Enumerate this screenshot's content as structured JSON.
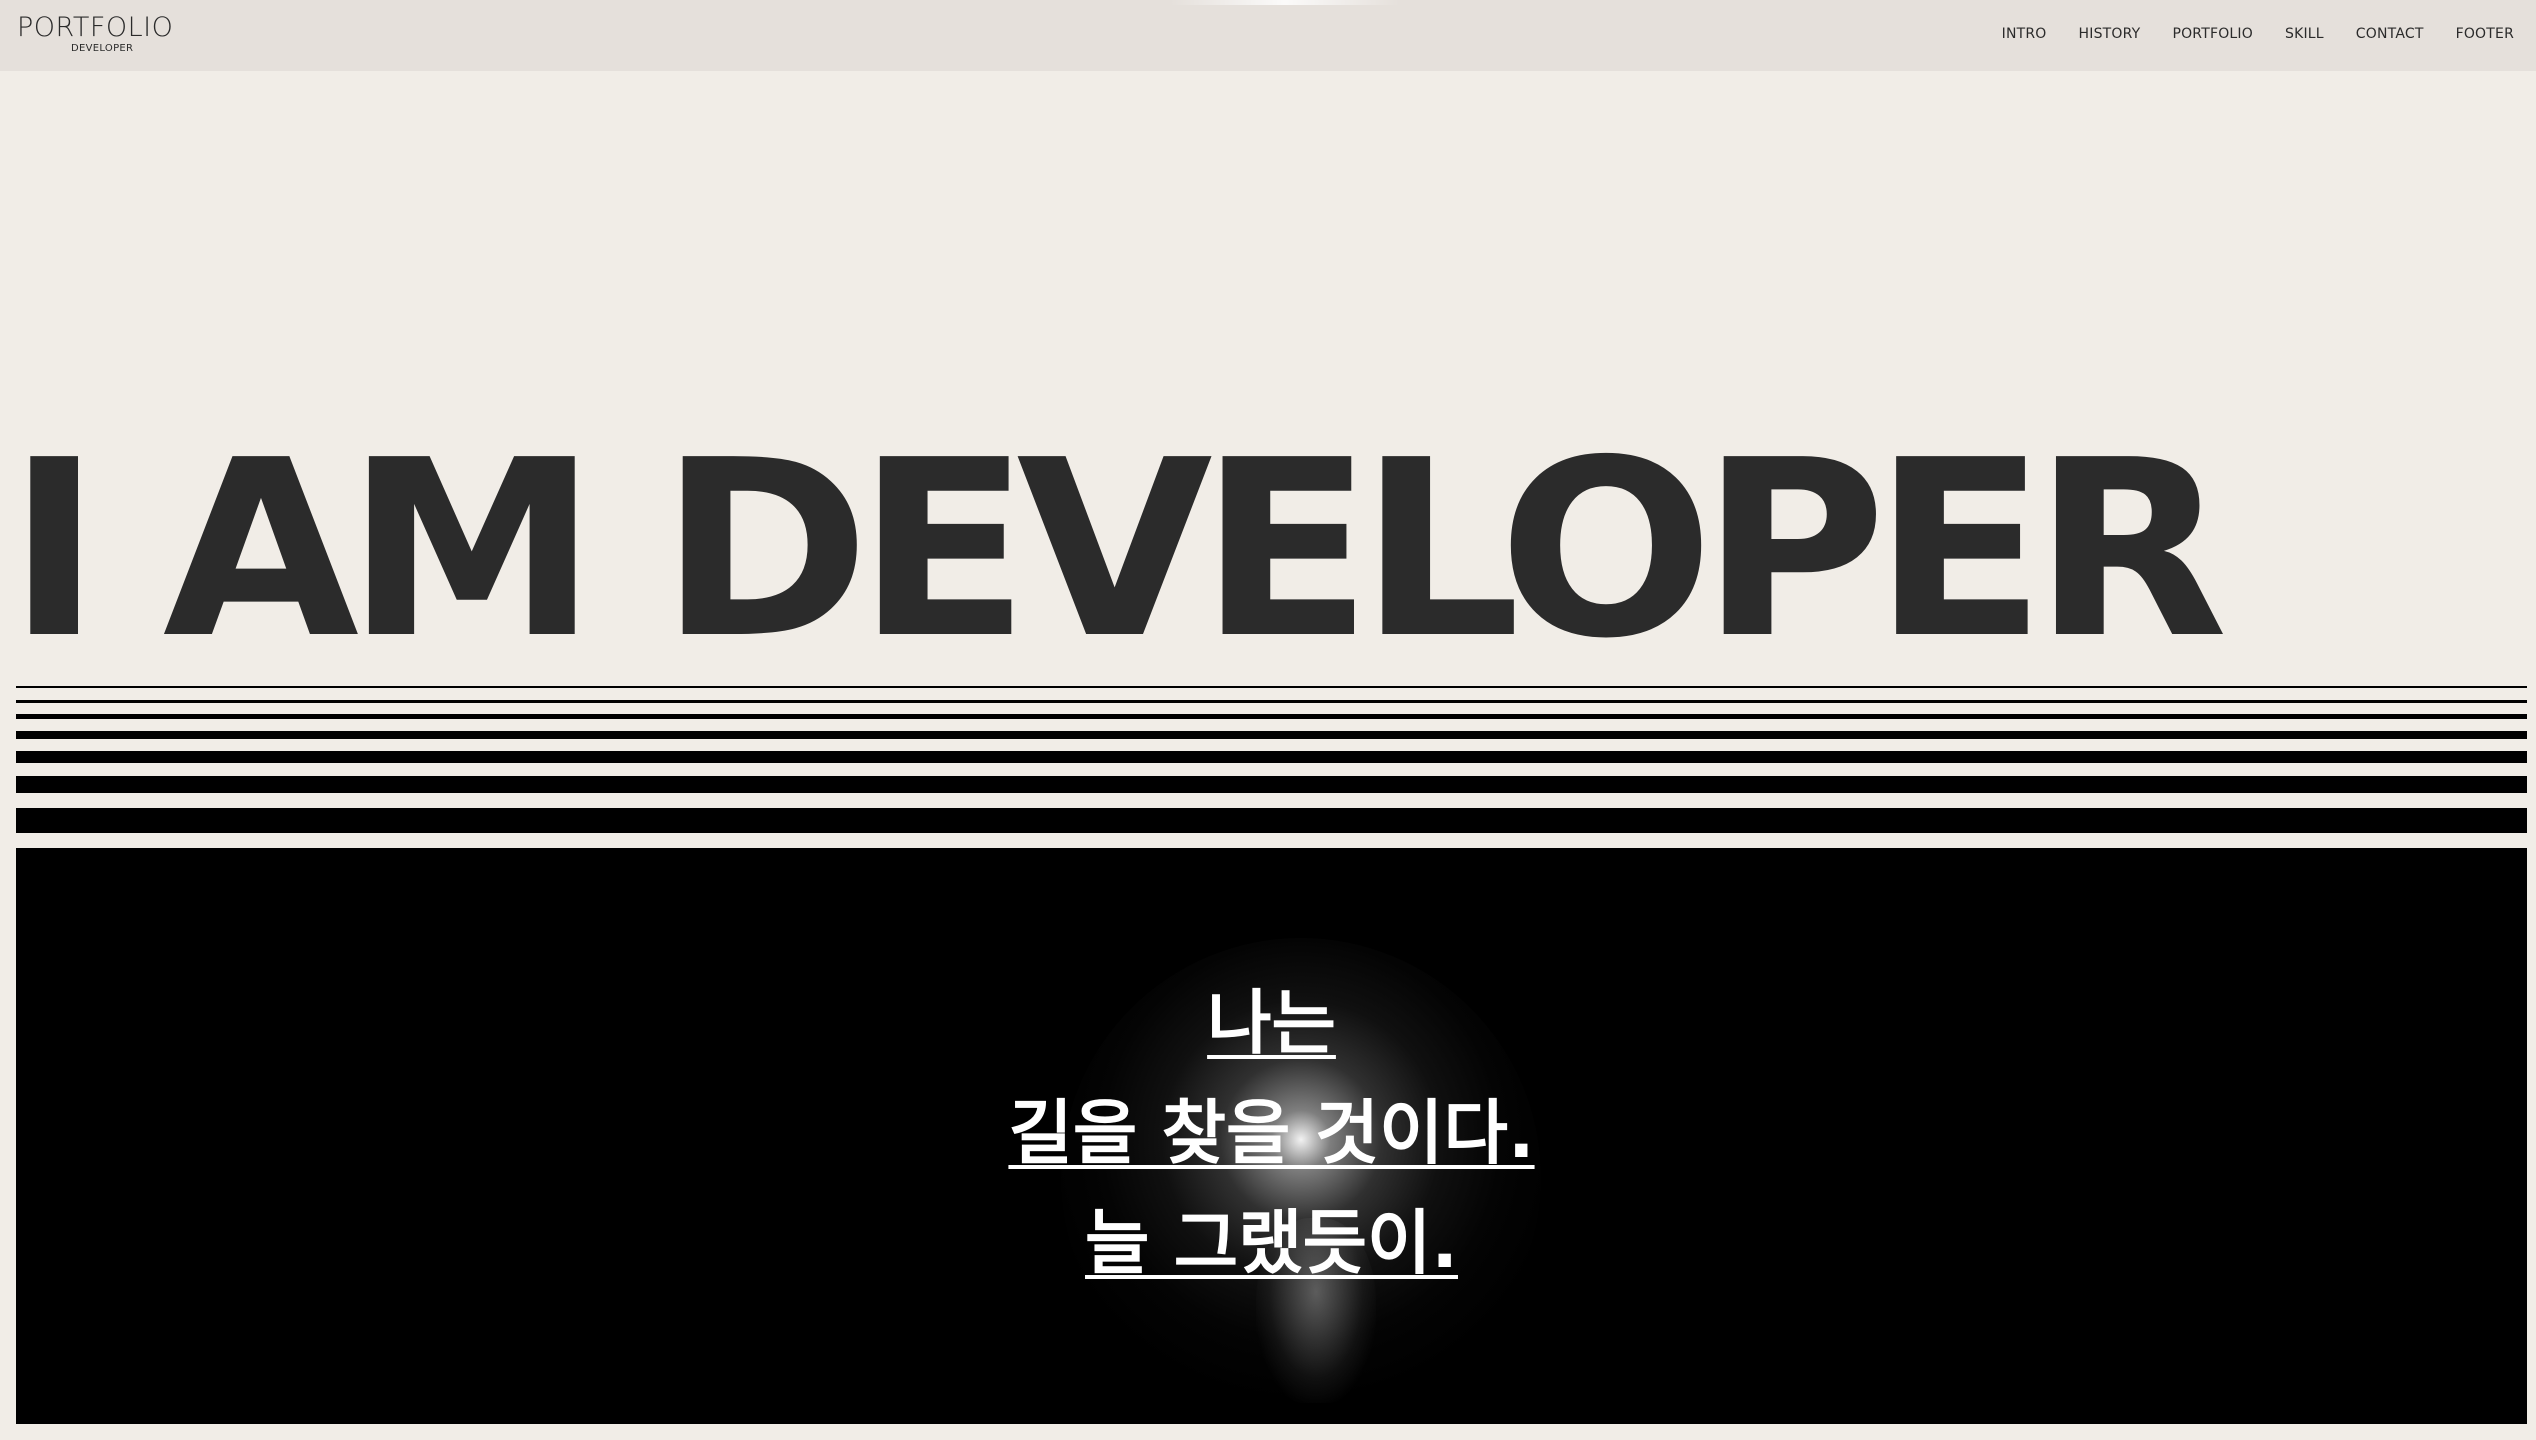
{
  "header": {
    "logo_title": "PORTFOLIO",
    "logo_subtitle": "DEVELOPER",
    "nav": [
      {
        "label": "INTRO"
      },
      {
        "label": "HISTORY"
      },
      {
        "label": "PORTFOLIO"
      },
      {
        "label": "SKILL"
      },
      {
        "label": "CONTACT"
      },
      {
        "label": "FOOTER"
      }
    ]
  },
  "hero": {
    "title": "I AM DEVELOPER"
  },
  "intro_panel": {
    "lines": [
      "나는",
      "길을 찾을 것이다.",
      "늘 그랬듯이."
    ],
    "background_image": "astronaut-in-galaxy"
  },
  "colors": {
    "page_background": "#f1ede7",
    "header_background": "#e5e0db",
    "text_dark": "#2b2b2b",
    "stripe": "#000000",
    "panel_background": "#000000",
    "quote_text": "#ffffff"
  }
}
